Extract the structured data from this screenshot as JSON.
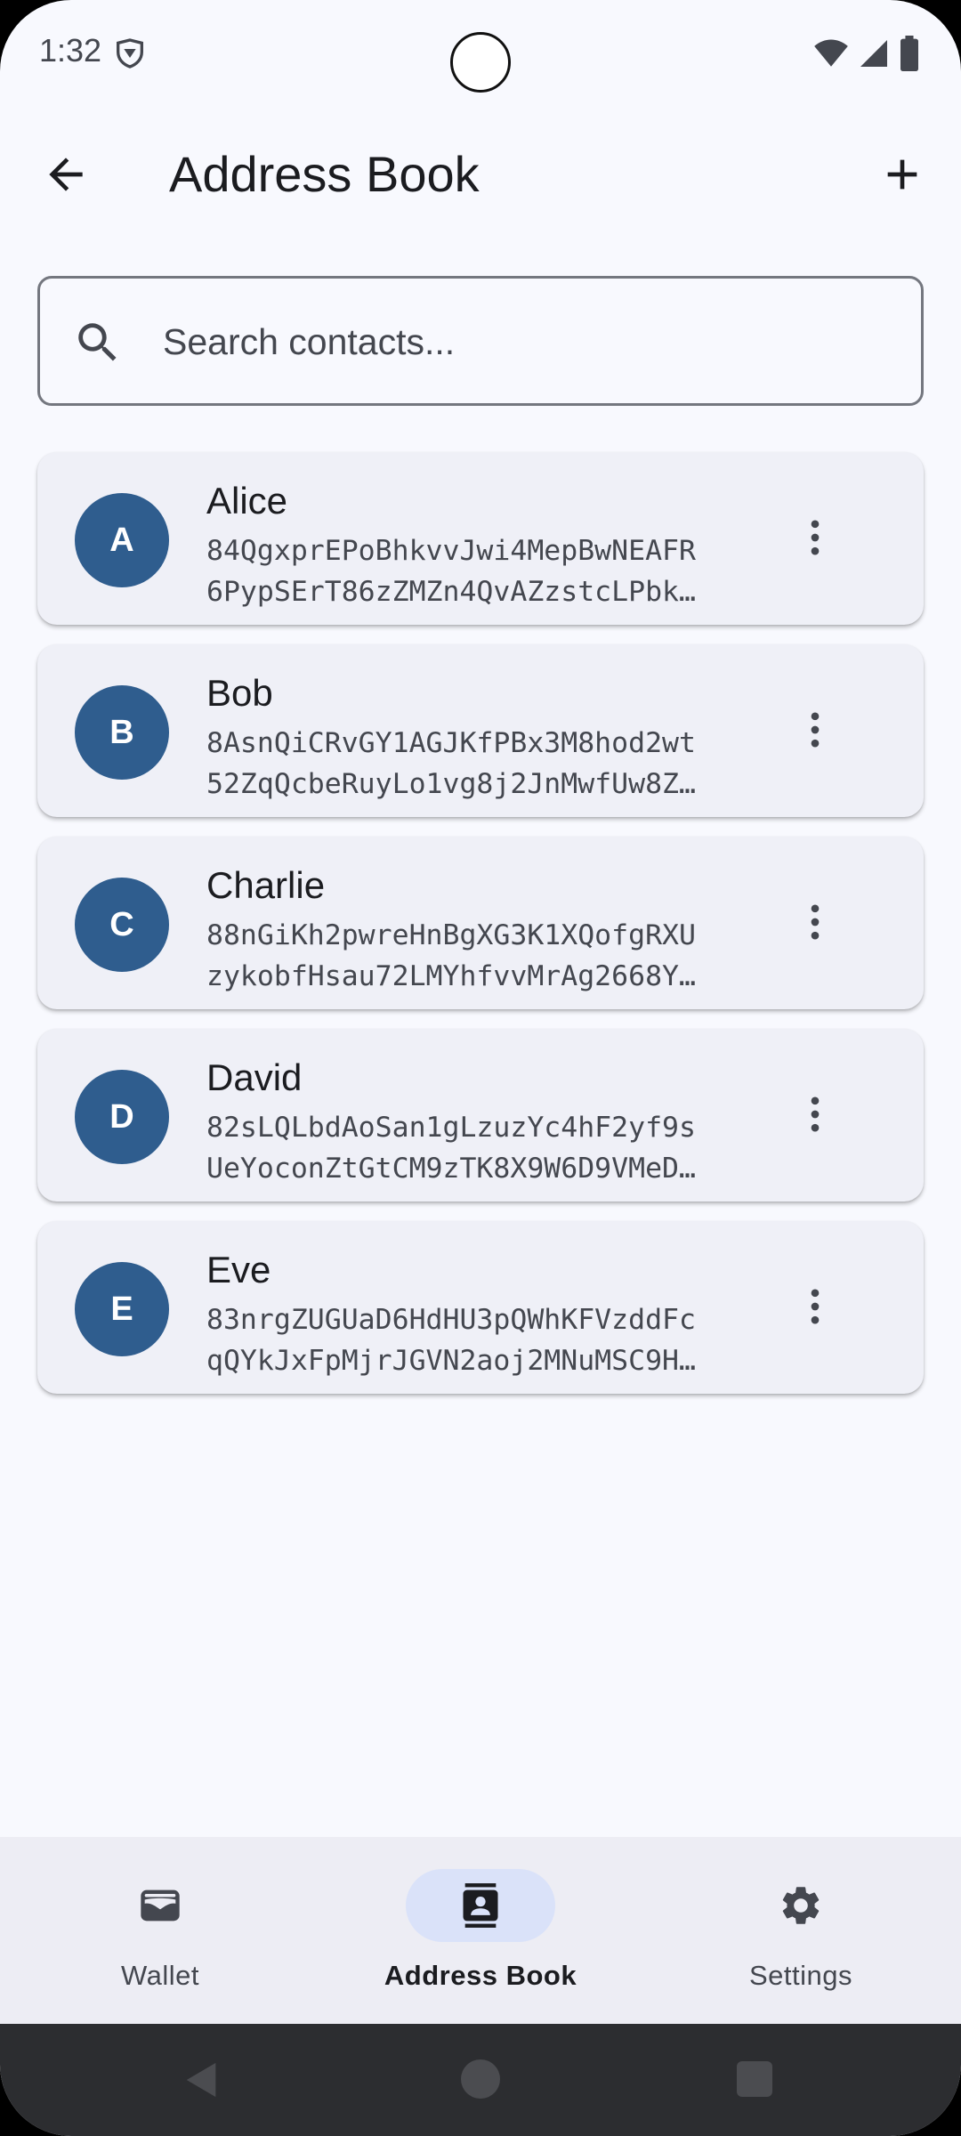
{
  "status_bar": {
    "time": "1:32"
  },
  "app_bar": {
    "title": "Address Book",
    "back_icon": "arrow-back-icon",
    "add_icon": "add-icon"
  },
  "search": {
    "placeholder": "Search contacts...",
    "value": ""
  },
  "contacts": [
    {
      "initial": "A",
      "name": "Alice",
      "address_line1": "84QgxprEPoBhkvvJwi4MepBwNEAFR",
      "address_line2": "6PypSErT86zZMZn4QvAZzstcLPbk…"
    },
    {
      "initial": "B",
      "name": "Bob",
      "address_line1": "8AsnQiCRvGY1AGJKfPBx3M8hod2wt",
      "address_line2": "52ZqQcbeRuyLo1vg8j2JnMwfUw8Z…"
    },
    {
      "initial": "C",
      "name": "Charlie",
      "address_line1": "88nGiKh2pwreHnBgXG3K1XQofgRXU",
      "address_line2": "zykobfHsau72LMYhfvvMrAg2668Y…"
    },
    {
      "initial": "D",
      "name": "David",
      "address_line1": "82sLQLbdAoSan1gLzuzYc4hF2yf9s",
      "address_line2": "UeYoconZtGtCM9zTK8X9W6D9VMeD…"
    },
    {
      "initial": "E",
      "name": "Eve",
      "address_line1": "83nrgZUGUaD6HdHU3pQWhKFVzddFc",
      "address_line2": "qQYkJxFpMjrJGVN2aoj2MNuMSC9H…"
    }
  ],
  "bottom_nav": {
    "items": [
      {
        "label": "Wallet",
        "icon": "wallet-icon",
        "active": false
      },
      {
        "label": "Address Book",
        "icon": "contacts-icon",
        "active": true
      },
      {
        "label": "Settings",
        "icon": "gear-icon",
        "active": false
      }
    ]
  },
  "colors": {
    "background": "#f8f9fe",
    "card": "#eff0f7",
    "avatar": "#2f5d8e",
    "nav_active_indicator": "#dae2f9",
    "nav_bar": "#ededf4",
    "system_nav": "#2c2d30"
  }
}
